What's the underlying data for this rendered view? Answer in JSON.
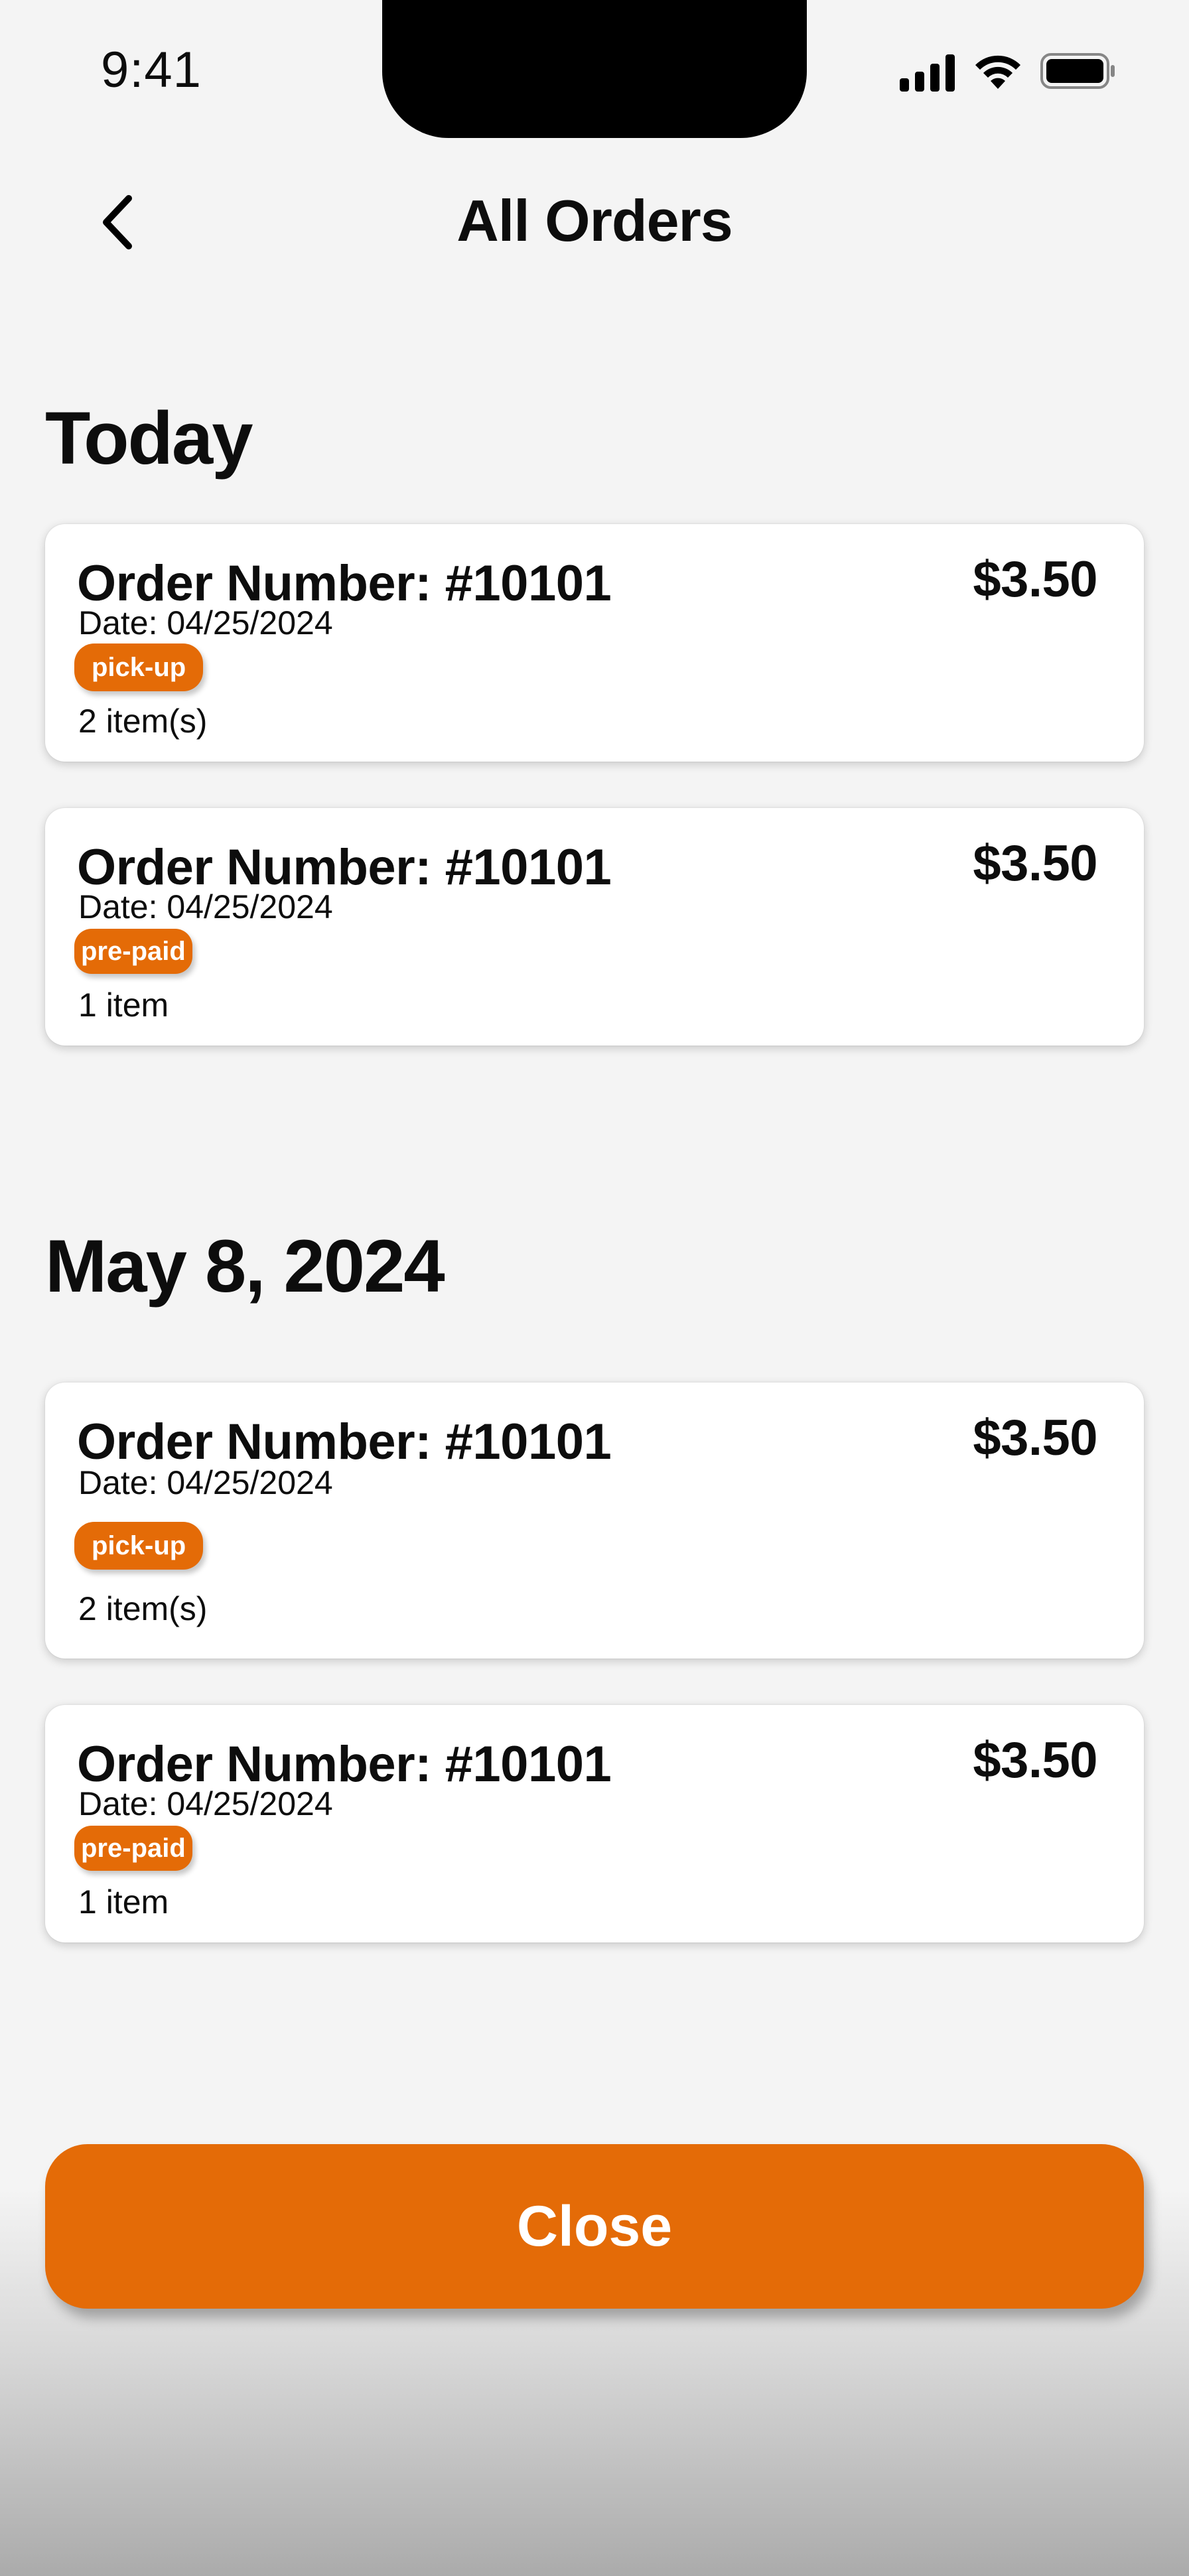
{
  "status_bar": {
    "time": "9:41",
    "icons": [
      "signal-icon",
      "wifi-icon",
      "battery-icon"
    ]
  },
  "header": {
    "title": "All Orders",
    "back_icon": "chevron-left-icon"
  },
  "sections": [
    {
      "heading": "Today",
      "orders": [
        {
          "number": "Order Number: #10101",
          "price": "$3.50",
          "date": "Date: 04/25/2024",
          "badge": "pick-up",
          "items": "2 item(s)"
        },
        {
          "number": "Order Number: #10101",
          "price": "$3.50",
          "date": "Date: 04/25/2024",
          "badge": "pre-paid",
          "items": "1 item"
        }
      ]
    },
    {
      "heading": "May 8, 2024",
      "orders": [
        {
          "number": "Order Number: #10101",
          "price": "$3.50",
          "date": "Date: 04/25/2024",
          "badge": "pick-up",
          "items": "2 item(s)"
        },
        {
          "number": "Order Number: #10101",
          "price": "$3.50",
          "date": "Date: 04/25/2024",
          "badge": "pre-paid",
          "items": "1 item"
        }
      ]
    }
  ],
  "footer": {
    "close_label": "Close"
  },
  "colors": {
    "accent": "#e46b07",
    "background": "#f4f4f4",
    "card": "#ffffff",
    "text": "#0d0d0d"
  }
}
